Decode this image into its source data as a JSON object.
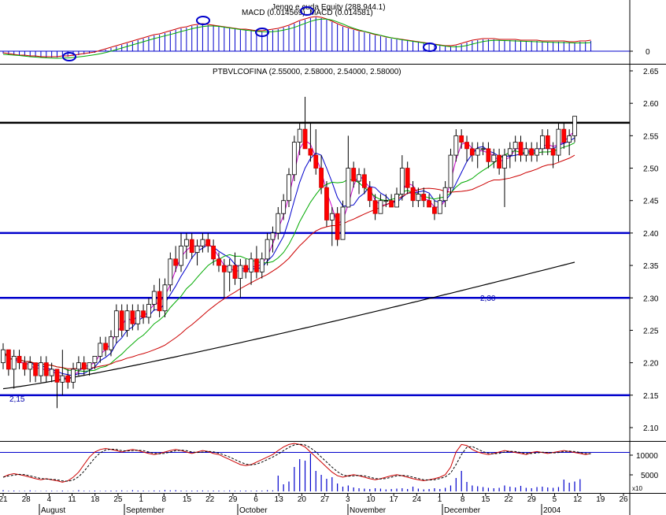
{
  "chart_data": {
    "type": "candlestick",
    "title": "PTBVLCOFINA (2.55000, 2.58000, 2.54000, 2.58000)",
    "macd_title": "MACD (0.014569), MACD (0.014581)",
    "overlay_label": "Jengo e cuda Equity (288,944.1)",
    "months": [
      "August",
      "September",
      "October",
      "November",
      "December",
      "2004"
    ],
    "date_ticks": [
      "21",
      "28",
      "4",
      "11",
      "18",
      "25",
      "1",
      "8",
      "15",
      "22",
      "29",
      "6",
      "13",
      "20",
      "27",
      "3",
      "10",
      "17",
      "24",
      "1",
      "8",
      "15",
      "22",
      "29",
      "5",
      "12",
      "19",
      "26"
    ],
    "price_ticks": [
      "2.65",
      "2.60",
      "2.55",
      "2.50",
      "2.45",
      "2.40",
      "2.35",
      "2.30",
      "2.25",
      "2.20",
      "2.15",
      "2.10"
    ],
    "ylim": [
      2.1,
      2.65
    ],
    "macd_ticks": [
      "0"
    ],
    "vol_ticks": [
      "10000",
      "5000"
    ],
    "vol_unit": "x10",
    "annotations": [
      "2,30",
      "2,15"
    ],
    "horizontal_levels": [
      {
        "value": 2.57,
        "color": "#000000"
      },
      {
        "value": 2.4,
        "color": "#0000cc"
      },
      {
        "value": 2.3,
        "color": "#0000cc"
      },
      {
        "value": 2.15,
        "color": "#0000cc"
      }
    ],
    "ma_colors": {
      "ma5": "#cc00cc",
      "ma10": "#0000cc",
      "ma20": "#00aa00",
      "ma50": "#cc0000",
      "ma200": "#000000"
    },
    "candles": [
      [
        2.2,
        2.23,
        2.19,
        2.22
      ],
      [
        2.22,
        2.22,
        2.18,
        2.19
      ],
      [
        2.19,
        2.22,
        2.16,
        2.21
      ],
      [
        2.21,
        2.22,
        2.19,
        2.2
      ],
      [
        2.2,
        2.21,
        2.18,
        2.19
      ],
      [
        2.19,
        2.21,
        2.17,
        2.2
      ],
      [
        2.2,
        2.2,
        2.17,
        2.18
      ],
      [
        2.18,
        2.21,
        2.17,
        2.2
      ],
      [
        2.2,
        2.21,
        2.17,
        2.18
      ],
      [
        2.18,
        2.2,
        2.17,
        2.19
      ],
      [
        2.19,
        2.19,
        2.13,
        2.17
      ],
      [
        2.17,
        2.22,
        2.15,
        2.18
      ],
      [
        2.18,
        2.19,
        2.16,
        2.17
      ],
      [
        2.17,
        2.2,
        2.16,
        2.19
      ],
      [
        2.19,
        2.21,
        2.18,
        2.2
      ],
      [
        2.2,
        2.21,
        2.18,
        2.19
      ],
      [
        2.19,
        2.2,
        2.18,
        2.2
      ],
      [
        2.2,
        2.21,
        2.19,
        2.21
      ],
      [
        2.21,
        2.24,
        2.2,
        2.23
      ],
      [
        2.23,
        2.24,
        2.21,
        2.22
      ],
      [
        2.22,
        2.25,
        2.21,
        2.24
      ],
      [
        2.24,
        2.29,
        2.23,
        2.28
      ],
      [
        2.28,
        2.29,
        2.24,
        2.25
      ],
      [
        2.25,
        2.29,
        2.24,
        2.28
      ],
      [
        2.28,
        2.29,
        2.25,
        2.26
      ],
      [
        2.26,
        2.29,
        2.25,
        2.28
      ],
      [
        2.28,
        2.29,
        2.26,
        2.27
      ],
      [
        2.27,
        2.3,
        2.26,
        2.29
      ],
      [
        2.29,
        2.32,
        2.28,
        2.31
      ],
      [
        2.31,
        2.33,
        2.27,
        2.28
      ],
      [
        2.28,
        2.33,
        2.27,
        2.32
      ],
      [
        2.32,
        2.37,
        2.31,
        2.36
      ],
      [
        2.36,
        2.38,
        2.34,
        2.35
      ],
      [
        2.35,
        2.4,
        2.34,
        2.38
      ],
      [
        2.38,
        2.4,
        2.36,
        2.39
      ],
      [
        2.39,
        2.4,
        2.36,
        2.37
      ],
      [
        2.37,
        2.39,
        2.35,
        2.38
      ],
      [
        2.38,
        2.4,
        2.37,
        2.39
      ],
      [
        2.39,
        2.4,
        2.37,
        2.38
      ],
      [
        2.38,
        2.39,
        2.35,
        2.36
      ],
      [
        2.36,
        2.37,
        2.34,
        2.35
      ],
      [
        2.35,
        2.36,
        2.3,
        2.34
      ],
      [
        2.34,
        2.36,
        2.31,
        2.35
      ],
      [
        2.35,
        2.37,
        2.32,
        2.33
      ],
      [
        2.33,
        2.36,
        2.3,
        2.35
      ],
      [
        2.35,
        2.36,
        2.33,
        2.34
      ],
      [
        2.34,
        2.37,
        2.32,
        2.36
      ],
      [
        2.36,
        2.38,
        2.33,
        2.34
      ],
      [
        2.34,
        2.37,
        2.33,
        2.36
      ],
      [
        2.36,
        2.4,
        2.35,
        2.39
      ],
      [
        2.39,
        2.41,
        2.37,
        2.4
      ],
      [
        2.4,
        2.44,
        2.39,
        2.43
      ],
      [
        2.43,
        2.46,
        2.42,
        2.45
      ],
      [
        2.45,
        2.5,
        2.44,
        2.49
      ],
      [
        2.49,
        2.55,
        2.48,
        2.54
      ],
      [
        2.54,
        2.57,
        2.52,
        2.56
      ],
      [
        2.56,
        2.61,
        2.55,
        2.53
      ],
      [
        2.53,
        2.57,
        2.51,
        2.52
      ],
      [
        2.52,
        2.56,
        2.49,
        2.5
      ],
      [
        2.5,
        2.52,
        2.46,
        2.47
      ],
      [
        2.47,
        2.48,
        2.41,
        2.42
      ],
      [
        2.42,
        2.44,
        2.38,
        2.43
      ],
      [
        2.43,
        2.44,
        2.38,
        2.39
      ],
      [
        2.39,
        2.45,
        2.39,
        2.44
      ],
      [
        2.44,
        2.55,
        2.44,
        2.5
      ],
      [
        2.5,
        2.51,
        2.47,
        2.48
      ],
      [
        2.48,
        2.5,
        2.46,
        2.49
      ],
      [
        2.49,
        2.5,
        2.46,
        2.47
      ],
      [
        2.47,
        2.48,
        2.44,
        2.45
      ],
      [
        2.45,
        2.46,
        2.42,
        2.43
      ],
      [
        2.43,
        2.46,
        2.43,
        2.45
      ],
      [
        2.45,
        2.46,
        2.44,
        2.45
      ],
      [
        2.45,
        2.46,
        2.44,
        2.44
      ],
      [
        2.44,
        2.47,
        2.44,
        2.46
      ],
      [
        2.46,
        2.52,
        2.45,
        2.5
      ],
      [
        2.5,
        2.51,
        2.46,
        2.47
      ],
      [
        2.47,
        2.48,
        2.44,
        2.45
      ],
      [
        2.45,
        2.47,
        2.44,
        2.46
      ],
      [
        2.46,
        2.47,
        2.44,
        2.45
      ],
      [
        2.45,
        2.46,
        2.44,
        2.44
      ],
      [
        2.44,
        2.45,
        2.42,
        2.43
      ],
      [
        2.43,
        2.46,
        2.43,
        2.45
      ],
      [
        2.45,
        2.48,
        2.44,
        2.47
      ],
      [
        2.47,
        2.53,
        2.46,
        2.52
      ],
      [
        2.52,
        2.56,
        2.51,
        2.55
      ],
      [
        2.55,
        2.56,
        2.53,
        2.54
      ],
      [
        2.54,
        2.55,
        2.51,
        2.53
      ],
      [
        2.53,
        2.54,
        2.51,
        2.52
      ],
      [
        2.52,
        2.54,
        2.5,
        2.53
      ],
      [
        2.53,
        2.54,
        2.52,
        2.53
      ],
      [
        2.53,
        2.54,
        2.5,
        2.51
      ],
      [
        2.51,
        2.53,
        2.5,
        2.52
      ],
      [
        2.52,
        2.53,
        2.49,
        2.5
      ],
      [
        2.5,
        2.53,
        2.44,
        2.52
      ],
      [
        2.52,
        2.54,
        2.5,
        2.53
      ],
      [
        2.53,
        2.55,
        2.51,
        2.54
      ],
      [
        2.54,
        2.55,
        2.51,
        2.52
      ],
      [
        2.52,
        2.54,
        2.51,
        2.53
      ],
      [
        2.53,
        2.54,
        2.51,
        2.52
      ],
      [
        2.52,
        2.54,
        2.51,
        2.53
      ],
      [
        2.53,
        2.56,
        2.52,
        2.55
      ],
      [
        2.55,
        2.56,
        2.52,
        2.53
      ],
      [
        2.53,
        2.54,
        2.5,
        2.52
      ],
      [
        2.52,
        2.57,
        2.51,
        2.56
      ],
      [
        2.56,
        2.57,
        2.53,
        2.54
      ],
      [
        2.54,
        2.56,
        2.52,
        2.55
      ],
      [
        2.55,
        2.58,
        2.54,
        2.58
      ]
    ],
    "volume": [
      300,
      150,
      200,
      100,
      120,
      250,
      100,
      80,
      120,
      150,
      100,
      200,
      80,
      100,
      300,
      150,
      120,
      200,
      100,
      150,
      200,
      180,
      250,
      120,
      300,
      200,
      180,
      150,
      220,
      180,
      350,
      250,
      300,
      200,
      150,
      180,
      200,
      220,
      150,
      180,
      200,
      120,
      250,
      150,
      180,
      200,
      150,
      200,
      180,
      300,
      250,
      4000,
      1800,
      2500,
      6200,
      8200,
      7800,
      9600,
      5200,
      4200,
      3200,
      3600,
      2000,
      1200,
      1500,
      1000,
      800,
      700,
      600,
      800,
      700,
      500,
      600,
      700,
      800,
      600,
      1200,
      700,
      500,
      600,
      800,
      600,
      900,
      1500,
      3400,
      5200,
      2400,
      1500,
      1300,
      1100,
      900,
      800,
      900,
      1500,
      1200,
      1000,
      1400,
      900,
      800,
      1100,
      1200,
      1000,
      900,
      1100,
      3000,
      2200,
      2500,
      3100
    ],
    "macd": [
      -0.003,
      -0.004,
      -0.005,
      -0.006,
      -0.006,
      -0.007,
      -0.007,
      -0.008,
      -0.008,
      -0.008,
      -0.008,
      -0.007,
      -0.007,
      -0.006,
      -0.005,
      -0.004,
      -0.003,
      -0.002,
      0.0,
      0.002,
      0.004,
      0.006,
      0.008,
      0.01,
      0.012,
      0.014,
      0.016,
      0.018,
      0.02,
      0.021,
      0.023,
      0.025,
      0.027,
      0.029,
      0.03,
      0.032,
      0.033,
      0.034,
      0.033,
      0.032,
      0.031,
      0.03,
      0.029,
      0.028,
      0.027,
      0.027,
      0.026,
      0.025,
      0.025,
      0.026,
      0.027,
      0.028,
      0.03,
      0.032,
      0.035,
      0.038,
      0.04,
      0.042,
      0.043,
      0.042,
      0.04,
      0.037,
      0.034,
      0.031,
      0.029,
      0.027,
      0.025,
      0.024,
      0.022,
      0.02,
      0.019,
      0.017,
      0.016,
      0.015,
      0.014,
      0.013,
      0.012,
      0.011,
      0.01,
      0.009,
      0.008,
      0.007,
      0.006,
      0.006,
      0.007,
      0.009,
      0.011,
      0.013,
      0.014,
      0.015,
      0.015,
      0.015,
      0.014,
      0.014,
      0.014,
      0.014,
      0.013,
      0.013,
      0.013,
      0.013,
      0.012,
      0.012,
      0.012,
      0.012,
      0.012,
      0.011,
      0.011,
      0.012,
      0.012,
      0.013
    ],
    "stoch": [
      25,
      30,
      32,
      30,
      28,
      25,
      22,
      20,
      22,
      20,
      18,
      15,
      18,
      25,
      35,
      50,
      65,
      75,
      80,
      82,
      80,
      78,
      75,
      78,
      80,
      78,
      75,
      72,
      70,
      72,
      75,
      78,
      80,
      78,
      75,
      72,
      75,
      78,
      76,
      72,
      70,
      65,
      60,
      55,
      50,
      48,
      50,
      55,
      60,
      65,
      70,
      78,
      85,
      90,
      92,
      90,
      85,
      75,
      65,
      55,
      45,
      35,
      28,
      25,
      28,
      30,
      28,
      25,
      22,
      20,
      22,
      25,
      28,
      30,
      28,
      25,
      22,
      20,
      18,
      20,
      22,
      25,
      30,
      45,
      75,
      90,
      88,
      80,
      75,
      72,
      70,
      72,
      75,
      78,
      76,
      74,
      72,
      70,
      74,
      76,
      74,
      72,
      74,
      76,
      78,
      76,
      74,
      72,
      70,
      72
    ]
  }
}
